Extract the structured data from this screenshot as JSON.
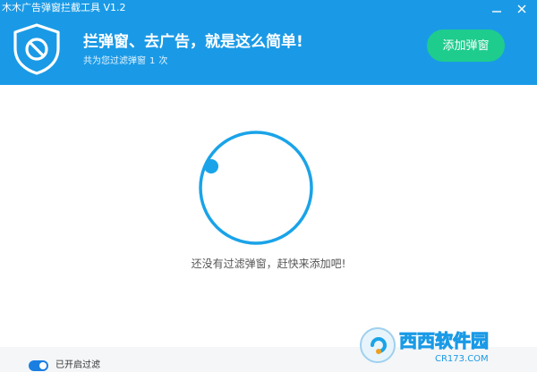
{
  "window": {
    "title": "木木广告弹窗拦截工具 V1.2"
  },
  "header": {
    "headline": "拦弹窗、去广告，就是这么简单!",
    "counter_prefix": "共为您过滤弹窗",
    "counter_value": "1",
    "counter_suffix": "次",
    "add_button_label": "添加弹窗"
  },
  "main": {
    "empty_message": "还没有过滤弹窗，赶快来添加吧!"
  },
  "footer": {
    "filter_enabled": true,
    "filter_label": "已开启过滤"
  },
  "watermark": {
    "brand_text": "西西软件园",
    "site_text": "CR173.COM"
  },
  "colors": {
    "header_bg": "#1a9ae6",
    "accent_green": "#1ecc8e",
    "ring_blue": "#1aa3e8",
    "toggle_blue": "#1a7fe0"
  },
  "icons": {
    "app_logo": "shield-ban-icon",
    "minimize": "minimize-icon",
    "close": "close-icon"
  }
}
